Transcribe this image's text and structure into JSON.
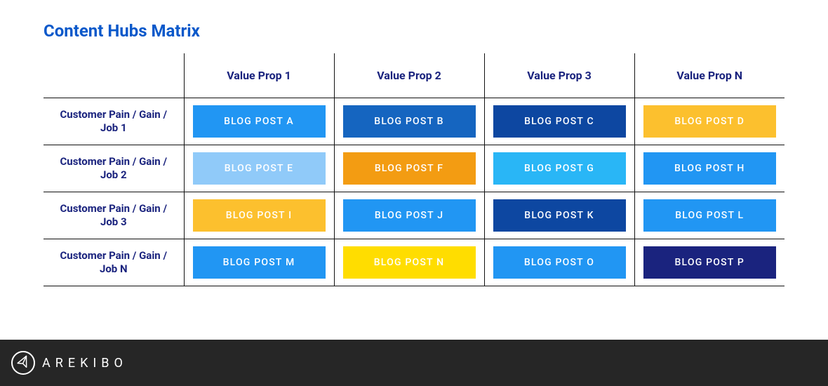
{
  "title": "Content Hubs Matrix",
  "columns": [
    "Value Prop 1",
    "Value Prop 2",
    "Value Prop 3",
    "Value Prop N"
  ],
  "rows": [
    {
      "label": "Customer Pain / Gain / Job 1",
      "cells": [
        {
          "label": "BLOG POST A",
          "color": "#2196f3"
        },
        {
          "label": "BLOG POST B",
          "color": "#1565c0"
        },
        {
          "label": "BLOG POST C",
          "color": "#0d47a1"
        },
        {
          "label": "BLOG POST D",
          "color": "#fcc02e"
        }
      ]
    },
    {
      "label": "Customer Pain / Gain / Job 2",
      "cells": [
        {
          "label": "BLOG POST E",
          "color": "#90caf9"
        },
        {
          "label": "BLOG POST F",
          "color": "#f39c12"
        },
        {
          "label": "BLOG POST G",
          "color": "#29b6f6"
        },
        {
          "label": "BLOG POST H",
          "color": "#2196f3"
        }
      ]
    },
    {
      "label": "Customer Pain / Gain / Job 3",
      "cells": [
        {
          "label": "BLOG POST I",
          "color": "#fcc02e"
        },
        {
          "label": "BLOG POST J",
          "color": "#2196f3"
        },
        {
          "label": "BLOG POST K",
          "color": "#0d47a1"
        },
        {
          "label": "BLOG POST L",
          "color": "#2196f3"
        }
      ]
    },
    {
      "label": "Customer Pain / Gain / Job N",
      "cells": [
        {
          "label": "BLOG POST M",
          "color": "#2196f3"
        },
        {
          "label": "BLOG POST N",
          "color": "#ffdd00"
        },
        {
          "label": "BLOG POST O",
          "color": "#2196f3"
        },
        {
          "label": "BLOG POST P",
          "color": "#1a237e"
        }
      ]
    }
  ],
  "footer": {
    "brand": "AREKIBO"
  }
}
